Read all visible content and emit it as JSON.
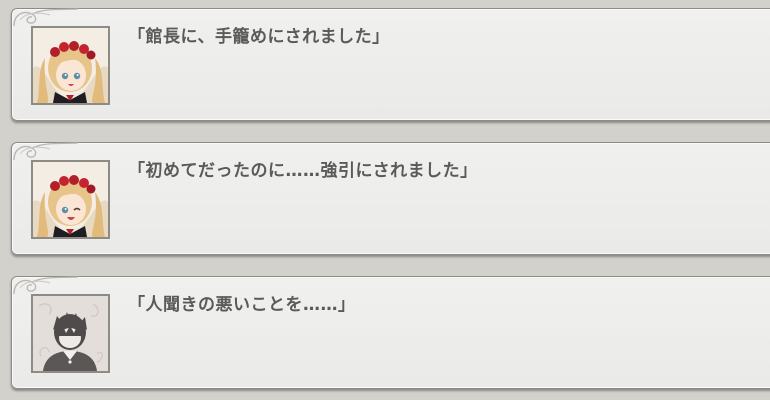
{
  "backlog": {
    "entries": [
      {
        "speaker_icon": "heroine-portrait-icon",
        "text": "「館長に、手籠めにされました」"
      },
      {
        "speaker_icon": "heroine-portrait-icon",
        "text": "「初めてだったのに……強引にされました」"
      },
      {
        "speaker_icon": "protagonist-silhouette-icon",
        "text": "「人聞きの悪いことを……」"
      }
    ]
  },
  "colors": {
    "panel": "#ececea",
    "panel_border": "#8d8c88",
    "text": "#5a5a58",
    "background": "#d2d1cc"
  }
}
